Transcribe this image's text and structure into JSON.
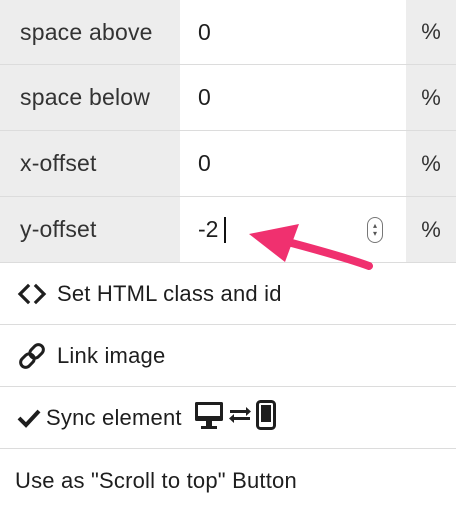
{
  "fields": [
    {
      "label": "space above",
      "value": "0",
      "unit": "%"
    },
    {
      "label": "space below",
      "value": "0",
      "unit": "%"
    },
    {
      "label": "x-offset",
      "value": "0",
      "unit": "%"
    },
    {
      "label": "y-offset",
      "value": "-2",
      "unit": "%"
    }
  ],
  "actions": {
    "set_html_class": {
      "label": "Set HTML class and id",
      "icon": "code-icon"
    },
    "link_image": {
      "label": "Link image",
      "icon": "link-icon"
    },
    "sync_element": {
      "label": "Sync element",
      "icon": "checkmark-icon",
      "device_icons": [
        "desktop-icon",
        "sync-arrows-icon",
        "mobile-icon"
      ]
    },
    "scroll_to_top": {
      "label": "Use as \"Scroll to top\" Button"
    }
  },
  "annotation": {
    "arrow_color": "#f0306f"
  }
}
